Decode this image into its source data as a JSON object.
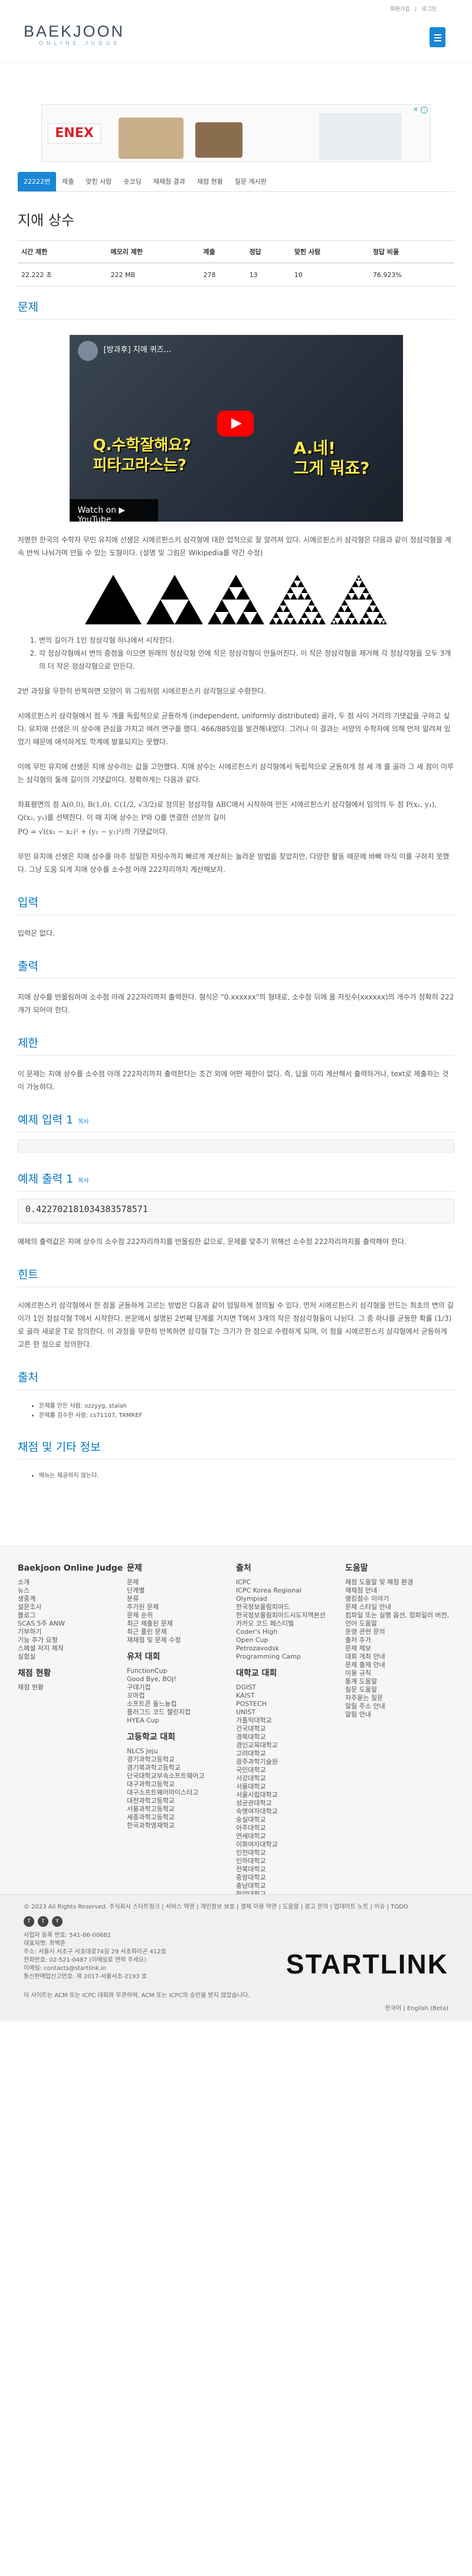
{
  "topbar": {
    "signup": "회원가입",
    "login": "로그인"
  },
  "logo": {
    "main": "BAEKJOON",
    "sub": "ONLINE JUDGE"
  },
  "ad": {
    "brand": "ENEX",
    "info": "i",
    "close": "✕"
  },
  "tabs": [
    "22222번",
    "제출",
    "맞힌 사람",
    "숏코딩",
    "재채점 결과",
    "채점 현황",
    "질문 게시판"
  ],
  "problem": {
    "title": "지애 상수",
    "stats_headers": [
      "시간 제한",
      "메모리 제한",
      "제출",
      "정답",
      "맞힌 사람",
      "정답 비율"
    ],
    "stats_values": [
      "22.222 초",
      "222 MB",
      "278",
      "13",
      "10",
      "76.923%"
    ]
  },
  "sections": {
    "problem": "문제",
    "input": "입력",
    "output": "출력",
    "limit": "제한",
    "sample_in": "예제 입력 1",
    "sample_out": "예제 출력 1",
    "copy": "복사",
    "hint": "힌트",
    "source": "출처",
    "tags": "채점 및 기타 정보"
  },
  "video": {
    "title": "[방과후] 지애 퀴즈... ",
    "bubble1": "Q.수학잘해요?\n피타고라스는?",
    "bubble2": "A.네!\n그게 뭐죠?",
    "watch": "Watch on ▶ YouTube"
  },
  "text": {
    "intro": "저명한 한국의 수학자 무민 유지애 선생은 시에르핀스키 삼각형에 대한 업적으로 잘 알려져 있다. 시에르핀스키 삼각형은 다음과 같이 정삼각형을 계속 반씩 나눠가며 만들 수 있는 도형이다. (설명 및 그림은 Wikipedia를 약간 수정)",
    "step1": "변의 길이가 1인 정삼각형 하나에서 시작한다.",
    "step2": "각 정삼각형에서 변의 중점을 이으면 원래의 정삼각형 안에 작은 정삼각형이 만들어진다. 이 작은 정삼각형을 제거해 각 정삼각형을 모두 3개의 더 작은 정삼각형으로 만든다.",
    "repeat": "2번 과정을 무한히 반복하면 모양이 위 그림처럼 시에르핀스키 삼각형으로 수렴한다.",
    "p2": "시에르핀스키 삼각형에서 점 두 개를 독립적으로 균등하게 (independent, uniformly distributed) 골라, 두 점 사이 거리의 기댓값을 구하고 싶다. 유지애 선생은 이 상수에 관심을 가지고 여러 연구를 했다. 466/885임을 발견해내었다. 그러나 이 결과는 서양의 수학자에 의해 먼저 알려져 있었기 때문에 애석하게도 학계에 발표되지는 못했다.",
    "p3": "이에 무민 유지애 선생은 지애 상수라는 값을 고안했다. 지애 상수는 시에르핀스키 삼각형에서 독립적으로 균등하게 점 세 개 를 골라 그 세 점이 이루는 삼각형의 둘레 길이의 기댓값이다. 정확하게는 다음과 같다.",
    "p4": "좌표평면의 점 A(0,0), B(1,0), C(1/2, √3/2)로 정의된 정삼각형 ABC에서 시작하여 만든 시에르핀스키 삼각형에서 임의의 두 점 P(x₁, y₁), Q(x₂, y₂)를 선택한다. 이 때 지애 상수는 P와 Q를 연결한 선분의 길이",
    "formula": "PQ = √((x₁ − x₂)² + (y₁ − y₂)²)의 기댓값이다.",
    "p5": "무민 유지애 선생은 지애 상수를 아주 정밀한 자릿수까지 빠르게 계산하는 놀라운 방법을 찾았지만, 다양한 활동 때문에 바빠 아직 이를 구하지 못했다. 그냥 도움 되게 지애 상수를 소수점 아래 222자리까지 계산해보자.",
    "input": "입력은 없다.",
    "output": "지애 상수를 반올림하여 소수점 아래 222자리까지 출력한다. 형식은 \"0.xxxxxx\"의 형태로, 소수점 뒤에 올 자릿수(xxxxxx)의 개수가 정확히 222개가 되어야 한다.",
    "limit": "이 문제는 지애 상수를 소수점 아래 222자리까지 출력한다는 조건 외에 어떤 제한이 없다. 즉, 답을 미리 계산해서 출력하거나, text로 제출하는 것이 가능하다.",
    "sample_output": "0.422702181034383578571",
    "sample_note": "예제의 출력값은 지애 상수의 소수점 222자리까지를 반올림한 값으로, 문제를 맞추기 위해선 소수점 222자리까지를 출력해야 한다.",
    "hint": "시에르핀스키 삼각형에서 한 점을 균등하게 고르는 방법은 다음과 같이 엄밀하게 정의될 수 있다. 먼저 시에르핀스키 삼각형을 만드는 최초의 변의 길이가 1인 정삼각형 T에서 시작한다. 본문에서 설명된 2번째 단계를 거치면 T에서 3개의 작은 정삼각형들이 나뉜다. 그 중 하나를 균등한 확률 (1/3)로 골라 새로운 T로 정의한다. 이 과정을 무한히 반복하면 삼각형 T는 크기가 한 점으로 수렴하게 되며, 이 점을 시에르핀스키 삼각형에서 균등하게 고른 한 점으로 정의한다.",
    "source1": "문제를 만든 사람: ozzyyg, stalah",
    "source2": "문제를 검수한 사람: cs71107, TAMREF",
    "tags": "메뉴는 제공하지 않는다."
  },
  "footer": {
    "col1_title": "Baekjoon Online Judge",
    "col1": [
      "소개",
      "뉴스",
      "생중계",
      "설문조사",
      "블로그",
      "SCAS 5주 ANW",
      "기부하기",
      "기능 추가 요청",
      "스페셜 저지 제작",
      "실험실"
    ],
    "col1b_title": "채점 현황",
    "col1b": [
      "채점 현황"
    ],
    "col2_title": "문제",
    "col2": [
      "문제",
      "단계별",
      "분류",
      "추가된 문제",
      "문제 순위",
      "최근 제출된 문제",
      "최근 풀린 문제",
      "재채점 및 문제 수정"
    ],
    "col2b_title": "유저 대회",
    "col2b": [
      "FunctionCup",
      "Good Bye, BOJ!",
      "구데기컵",
      "꼬마컵",
      "소프트콘 돌느뇽컵",
      "플러그드 코드 챌린지컵",
      "HYEA Cup"
    ],
    "col2c_title": "고등학교 대회",
    "col2c": [
      "NLCS Jeju",
      "경기과학고등학교",
      "경기북과학고등학교",
      "단국대학교부속소프트웨어고",
      "대구과학고등학교",
      "대구소프트웨어마이스터고",
      "대전과학고등학교",
      "서울과학고등학교",
      "세종과학고등학교",
      "한국과학영재학교"
    ],
    "col3_title": "출처",
    "col3": [
      "ICPC",
      "ICPC Korea Regional",
      "Olympiad",
      "한국정보올림피아드",
      "한국정보올림피아드시도지역본선",
      "카카오 코드 페스티벌",
      "Coder's High",
      "Open Cup",
      "Petrozavodsk",
      "Programming Camp"
    ],
    "col3b_title": "대학교 대회",
    "col3b": [
      "DGIST",
      "KAIST",
      "POSTECH",
      "UNIST",
      "가톨릭대학교",
      "건국대학교",
      "경북대학교",
      "경인교육대학교",
      "고려대학교",
      "광주과학기술원",
      "국민대학교",
      "서강대학교",
      "서울대학교",
      "서울시립대학교",
      "성균관대학교",
      "숙명여자대학교",
      "숭실대학교",
      "아주대학교",
      "연세대학교",
      "이화여자대학교",
      "인천대학교",
      "인하대학교",
      "전북대학교",
      "중앙대학교",
      "충남대학교",
      "한양대학교",
      "홍익대학교",
      "하나고등학교"
    ],
    "col4_title": "도움말",
    "col4": [
      "채점 도움말 및 채점 환경",
      "재채점 안내",
      "랭킹점수 이야기",
      "문제 스타일 안내",
      "컴파일 또는 실행 옵션, 컴파일러 버전, 언어 도움말",
      "운영 관련 문의",
      "출처 추가",
      "문제 제보",
      "대회 개최 안내",
      "문제 출제 안내",
      "이용 규칙",
      "통계 도움말",
      "질문 도움말",
      "자주묻는 질문",
      "알릴 주소 안내",
      "알림 안내"
    ]
  },
  "bottom": {
    "copyright": "© 2023 All Rights Reserved. 주식회사 스타트링크 | 서비스 약관 | 개인정보 보호 | 결제 이용 약관 | 도움말 | 광고 문의 | 업데이트 노트 | 이슈 | TODO",
    "social": [
      "f",
      "t",
      "Y"
    ],
    "company": "사업자 등록 번호: 541-86-00682",
    "ceo": "대표자명: 최백준",
    "address": "주소: 서울시 서초구 서초대로74길 29 서초파라곤 412호",
    "phone": "전화번호: 02-521-0487 (이메일로 연락 주세요)",
    "email": "이메일: contacts@startlink.io",
    "license": "통신판매업신고번호: 제 2017-서울서초-2193 호",
    "note": "이 사이트는 ACM 또는 ICPC 대회와 무관하며, ACM 또는 ICPC의 승인을 받지 않았습니다.",
    "brand": "STARTLINK",
    "lang": "한국어 | English (Beta)"
  }
}
